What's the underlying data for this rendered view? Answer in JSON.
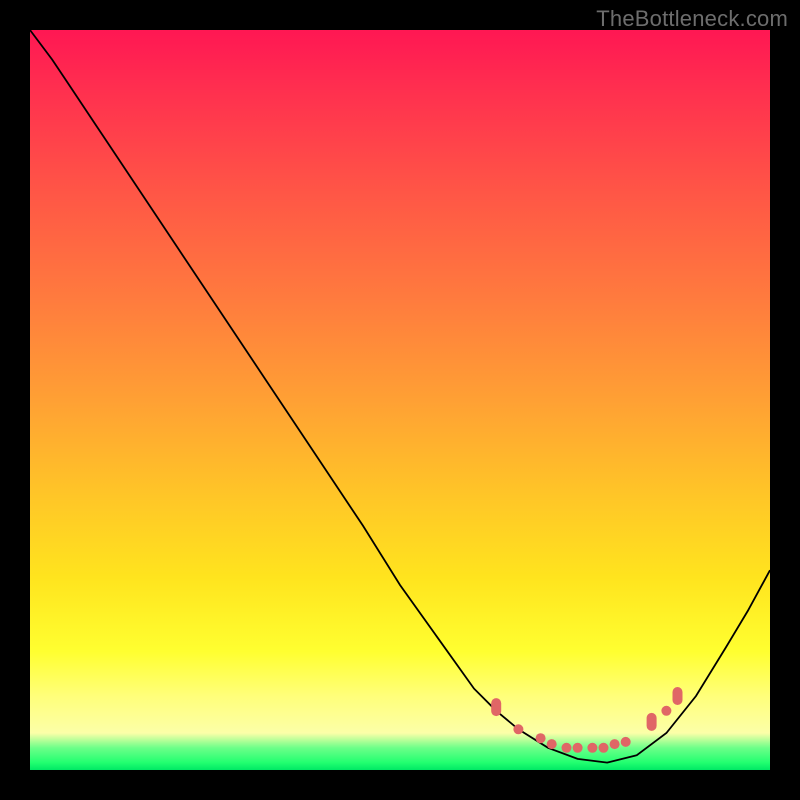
{
  "watermark": "TheBottleneck.com",
  "colors": {
    "frame": "#000000",
    "dot": "#e06666",
    "curve": "#000000",
    "gradient_stops": [
      "#ff1753",
      "#ff2f4f",
      "#ff5646",
      "#ff7a3e",
      "#ffa034",
      "#ffc328",
      "#ffe41e",
      "#ffff30",
      "#ffff7a",
      "#fcffa8",
      "#6dff89",
      "#22ff70",
      "#00e865"
    ]
  },
  "chart_data": {
    "type": "line",
    "title": "",
    "xlabel": "",
    "ylabel": "",
    "xlim": [
      0,
      100
    ],
    "ylim": [
      0,
      100
    ],
    "note": "Single black curve over a red→yellow→green vertical gradient. Curve descends steeply from top-left, bottoms out near x≈75, then rises toward the right edge. A cluster of salmon-colored markers sits in the trough region near the bottom. Values estimated from pixel positions on a 0–100 normalized axes.",
    "series": [
      {
        "name": "curve",
        "x": [
          0,
          3,
          5,
          10,
          15,
          20,
          25,
          30,
          35,
          40,
          45,
          50,
          55,
          60,
          63,
          66,
          70,
          74,
          78,
          82,
          86,
          90,
          94,
          97,
          100
        ],
        "y": [
          100,
          96,
          93,
          85.5,
          78,
          70.5,
          63,
          55.5,
          48,
          40.5,
          33,
          25,
          18,
          11,
          8,
          5.5,
          3,
          1.5,
          1,
          2,
          5,
          10,
          16.5,
          21.5,
          27
        ]
      }
    ],
    "markers": {
      "name": "highlight-dots",
      "points": [
        {
          "x": 63,
          "y": 8.5,
          "shape": "pill"
        },
        {
          "x": 66,
          "y": 5.5,
          "shape": "dot"
        },
        {
          "x": 69,
          "y": 4.3,
          "shape": "dot"
        },
        {
          "x": 70.5,
          "y": 3.5,
          "shape": "dot"
        },
        {
          "x": 72.5,
          "y": 3.0,
          "shape": "dot"
        },
        {
          "x": 74,
          "y": 3.0,
          "shape": "dot"
        },
        {
          "x": 76,
          "y": 3.0,
          "shape": "dot"
        },
        {
          "x": 77.5,
          "y": 3.0,
          "shape": "dot"
        },
        {
          "x": 79,
          "y": 3.5,
          "shape": "dot"
        },
        {
          "x": 80.5,
          "y": 3.8,
          "shape": "dot"
        },
        {
          "x": 84,
          "y": 6.5,
          "shape": "pill"
        },
        {
          "x": 86,
          "y": 8.0,
          "shape": "dot"
        },
        {
          "x": 87.5,
          "y": 10.0,
          "shape": "pill"
        }
      ]
    }
  }
}
